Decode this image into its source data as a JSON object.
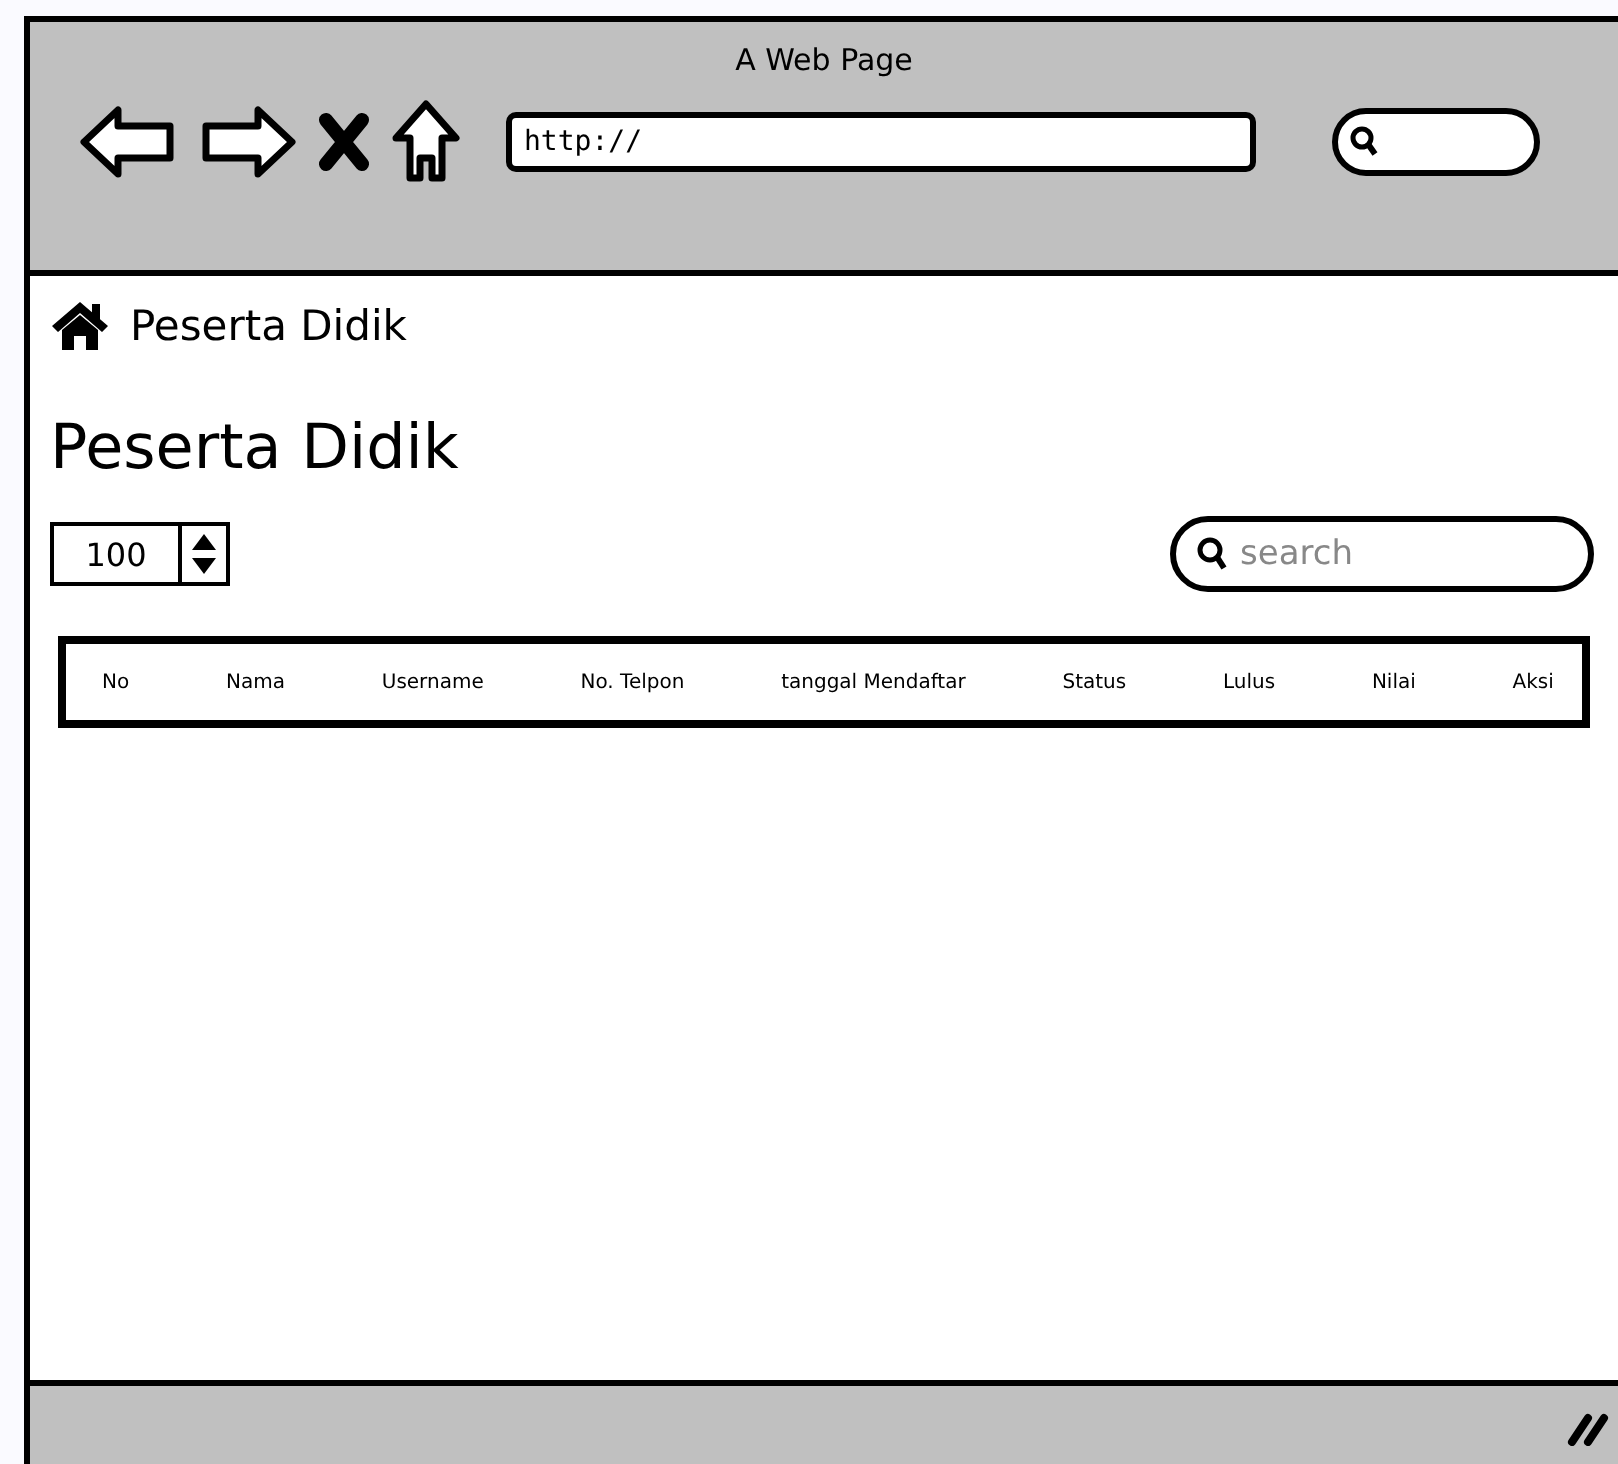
{
  "window": {
    "title": "A Web Page"
  },
  "address_bar": {
    "value": "http://"
  },
  "breadcrumb": {
    "label": "Peserta Didik"
  },
  "heading": "Peserta Didik",
  "page_size": {
    "value": "100"
  },
  "search": {
    "placeholder": "search"
  },
  "table": {
    "columns": [
      "No",
      "Nama",
      "Username",
      "No. Telpon",
      "tanggal Mendaftar",
      "Status",
      "Lulus",
      "Nilai",
      "Aksi"
    ]
  }
}
